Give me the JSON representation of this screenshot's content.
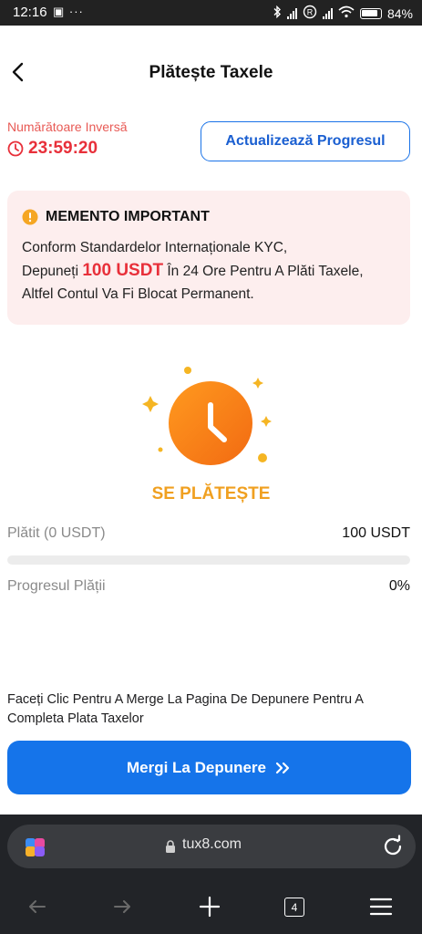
{
  "status_bar": {
    "time": "12:16",
    "left_icons": "▣ ···",
    "battery": "84%"
  },
  "header": {
    "title": "Plătește Taxele",
    "back_icon": "chevron-left-icon"
  },
  "countdown": {
    "label": "Numărătoare Inversă",
    "time": "23:59:20"
  },
  "refresh_button": "Actualizează Progresul",
  "notice": {
    "heading": "MEMENTO IMPORTANT",
    "line1": "Conform Standardelor Internaționale KYC,",
    "prefix": "Depuneți",
    "amount": "100 USDT",
    "suffix": "În 24 Ore Pentru A Plăti Taxele, Altfel Contul Va Fi Blocat Permanent."
  },
  "payment_status": "SE PLĂTEȘTE",
  "paid": {
    "label": "Plătit (0 USDT)",
    "value": "100 USDT"
  },
  "progress": {
    "label": "Progresul Plății",
    "value": "0%",
    "fraction": 0
  },
  "instruction": "Faceți Clic Pentru A Merge La Pagina De Depunere Pentru A Completa Plata Taxelor",
  "deposit_button": "Mergi La Depunere",
  "browser": {
    "url": "tux8.com",
    "tab_count": "4"
  },
  "colors": {
    "accent": "#1574ea",
    "alert": "#e8303a",
    "pending": "#f0a020"
  }
}
